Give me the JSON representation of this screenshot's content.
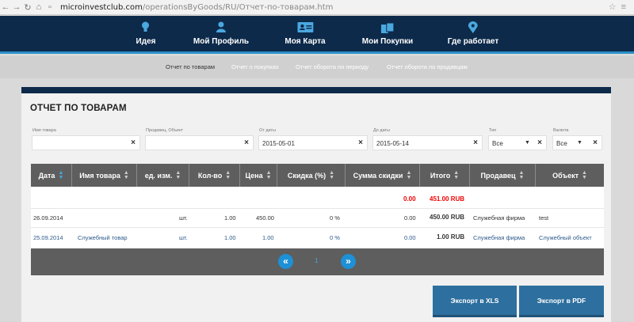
{
  "browser": {
    "url_host": "microinvestclub.com",
    "url_path": "/operationsByGoods/RU/Отчет-по-товарам.htm"
  },
  "topnav": {
    "items": [
      {
        "label": "Идея",
        "icon": "bulb-icon"
      },
      {
        "label": "Мой Профиль",
        "icon": "user-icon"
      },
      {
        "label": "Моя Карта",
        "icon": "card-icon"
      },
      {
        "label": "Мои Покупки",
        "icon": "shopping-icon"
      },
      {
        "label": "Где работает",
        "icon": "map-pin-icon"
      }
    ]
  },
  "subnav": {
    "items": [
      {
        "label": "Отчет по товарам",
        "active": true
      },
      {
        "label": "Отчет о покупках",
        "active": false
      },
      {
        "label": "Отчет оборота по периоду",
        "active": false
      },
      {
        "label": "Отчет оборота по продавцам",
        "active": false
      }
    ]
  },
  "page_title": "ОТЧЕТ ПО ТОВАРАМ",
  "filters": {
    "product_name": {
      "label": "Имя товара",
      "value": ""
    },
    "seller_object": {
      "label": "Продавец, Объект",
      "value": ""
    },
    "date_from": {
      "label": "От даты",
      "value": "2015-05-01"
    },
    "date_to": {
      "label": "До даты",
      "value": "2015-05-14"
    },
    "type": {
      "label": "Тип",
      "value": "Все"
    },
    "currency": {
      "label": "Валюта",
      "value": "Все"
    }
  },
  "table": {
    "columns": [
      "Дата",
      "Имя товара",
      "ед. изм.",
      "Кол-во",
      "Цена",
      "Скидка (%)",
      "Сумма скидки",
      "Итого",
      "Продавец",
      "Объект"
    ],
    "totals": {
      "discount_sum": "0.00",
      "total": "451.00 RUB"
    },
    "rows": [
      {
        "date": "26.09.2014",
        "name": "",
        "unit": "шт.",
        "qty": "1.00",
        "price": "450.00",
        "discount": "0 %",
        "discount_sum": "0.00",
        "total": "450.00 RUB",
        "seller": "Служебная фирма",
        "object": "test"
      },
      {
        "date": "25.09.2014",
        "name": "Служебный товар",
        "unit": "шт.",
        "qty": "1.00",
        "price": "1.00",
        "discount": "0 %",
        "discount_sum": "0.00",
        "total": "1.00 RUB",
        "seller": "Служебная фирма",
        "object": "Служебный объект"
      }
    ]
  },
  "pagination": {
    "current_page": "1",
    "prev": "«",
    "next": "»"
  },
  "export": {
    "xls": "Экспорт в XLS",
    "pdf": "Экспорт в PDF"
  },
  "colors": {
    "nav_bg": "#0d2a4a",
    "accent": "#2b8fc9",
    "red": "#e00000"
  }
}
